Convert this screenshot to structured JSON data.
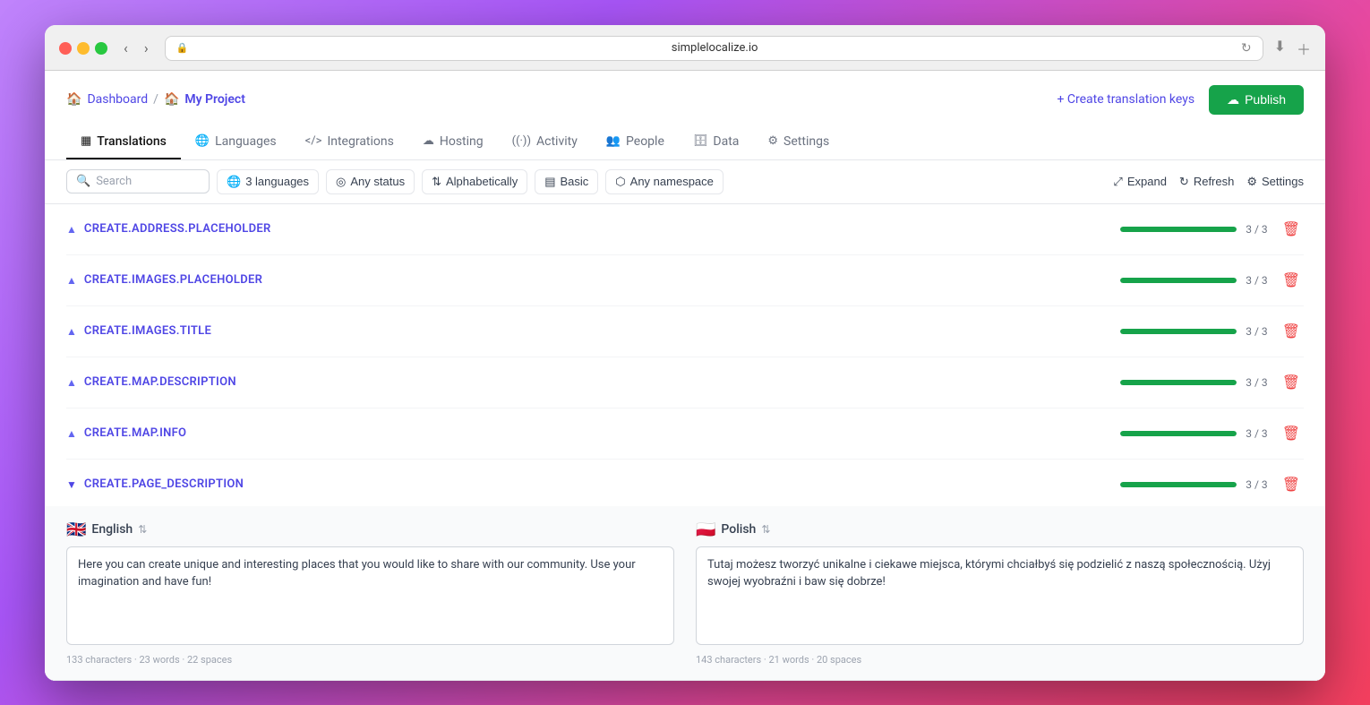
{
  "browser": {
    "url": "simplelocalize.io",
    "back_arrow": "‹",
    "forward_arrow": "›"
  },
  "breadcrumb": {
    "home_label": "Dashboard",
    "separator": "/",
    "project_emoji": "🏠",
    "project_name": "My Project"
  },
  "header_actions": {
    "create_keys_label": "+ Create translation keys",
    "publish_label": "Publish",
    "publish_icon": "☁"
  },
  "nav_tabs": [
    {
      "id": "translations",
      "icon": "▦",
      "label": "Translations",
      "active": true
    },
    {
      "id": "languages",
      "icon": "🌐",
      "label": "Languages",
      "active": false
    },
    {
      "id": "integrations",
      "icon": "</>",
      "label": "Integrations",
      "active": false
    },
    {
      "id": "hosting",
      "icon": "☁",
      "label": "Hosting",
      "active": false
    },
    {
      "id": "activity",
      "icon": "((·))",
      "label": "Activity",
      "active": false
    },
    {
      "id": "people",
      "icon": "👥",
      "label": "People",
      "active": false
    },
    {
      "id": "data",
      "icon": "🗄",
      "label": "Data",
      "active": false
    },
    {
      "id": "settings",
      "icon": "⚙",
      "label": "Settings",
      "active": false
    }
  ],
  "toolbar": {
    "search_placeholder": "Search",
    "filters": [
      {
        "id": "languages",
        "icon": "🌐",
        "label": "3 languages"
      },
      {
        "id": "status",
        "icon": "◎",
        "label": "Any status"
      },
      {
        "id": "sort",
        "icon": "⇅",
        "label": "Alphabetically"
      },
      {
        "id": "view",
        "icon": "▤",
        "label": "Basic"
      },
      {
        "id": "namespace",
        "icon": "⬡",
        "label": "Any namespace"
      }
    ],
    "actions": [
      {
        "id": "expand",
        "icon": "⤢",
        "label": "Expand"
      },
      {
        "id": "refresh",
        "icon": "↻",
        "label": "Refresh"
      },
      {
        "id": "settings",
        "icon": "⚙",
        "label": "Settings"
      }
    ]
  },
  "translation_rows": [
    {
      "id": "row1",
      "key": "CREATE.ADDRESS.PLACEHOLDER",
      "progress": 100,
      "count": "3 / 3",
      "expanded": false
    },
    {
      "id": "row2",
      "key": "CREATE.IMAGES.PLACEHOLDER",
      "progress": 100,
      "count": "3 / 3",
      "expanded": false
    },
    {
      "id": "row3",
      "key": "CREATE.IMAGES.TITLE",
      "progress": 100,
      "count": "3 / 3",
      "expanded": false
    },
    {
      "id": "row4",
      "key": "CREATE.MAP.DESCRIPTION",
      "progress": 100,
      "count": "3 / 3",
      "expanded": false
    },
    {
      "id": "row5",
      "key": "CREATE.MAP.INFO",
      "progress": 100,
      "count": "3 / 3",
      "expanded": false
    },
    {
      "id": "row6",
      "key": "CREATE.PAGE_DESCRIPTION",
      "progress": 100,
      "count": "3 / 3",
      "expanded": true
    }
  ],
  "expanded_translation": {
    "key": "CREATE.PAGE_DESCRIPTION",
    "languages": [
      {
        "id": "english",
        "flag": "🇬🇧",
        "name": "English",
        "sort_icon": "⇅",
        "value": "Here you can create unique and interesting places that you would like to share with our community. Use your imagination and have fun!",
        "stats": "133 characters · 23 words · 22 spaces"
      },
      {
        "id": "polish",
        "flag": "🇵🇱",
        "name": "Polish",
        "sort_icon": "⇅",
        "value": "Tutaj możesz tworzyć unikalne i ciekawe miejsca, którymi chciałbyś się podzielić z naszą społecznością. Użyj swojej wyobraźni i baw się dobrze!",
        "stats": "143 characters · 21 words · 20 spaces"
      }
    ]
  },
  "colors": {
    "accent": "#4f46e5",
    "green": "#16a34a",
    "red": "#ef4444",
    "active_tab_border": "#111"
  }
}
